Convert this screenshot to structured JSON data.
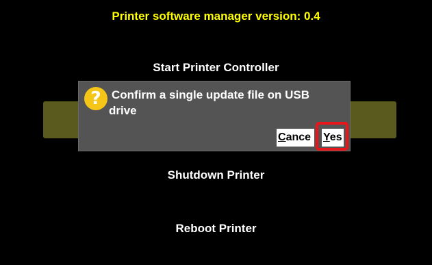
{
  "header": {
    "title": "Printer software manager version: 0.4"
  },
  "menu": {
    "start_label": "Start Printer Controller",
    "shutdown_label": "Shutdown Printer",
    "reboot_label": "Reboot Printer"
  },
  "dialog": {
    "icon": "question-icon",
    "icon_glyph": "?",
    "message_line1": "Confirm a single update file on USB",
    "message_line2": "drive",
    "cancel_first": "C",
    "cancel_rest": "ance",
    "yes_first": "Y",
    "yes_rest": "es"
  },
  "colors": {
    "background": "#000000",
    "title": "#ffff00",
    "highlight": "#5a5a1e",
    "dialog": "#545454",
    "question_icon": "#f5c518",
    "focus_ring": "#e8161b"
  }
}
